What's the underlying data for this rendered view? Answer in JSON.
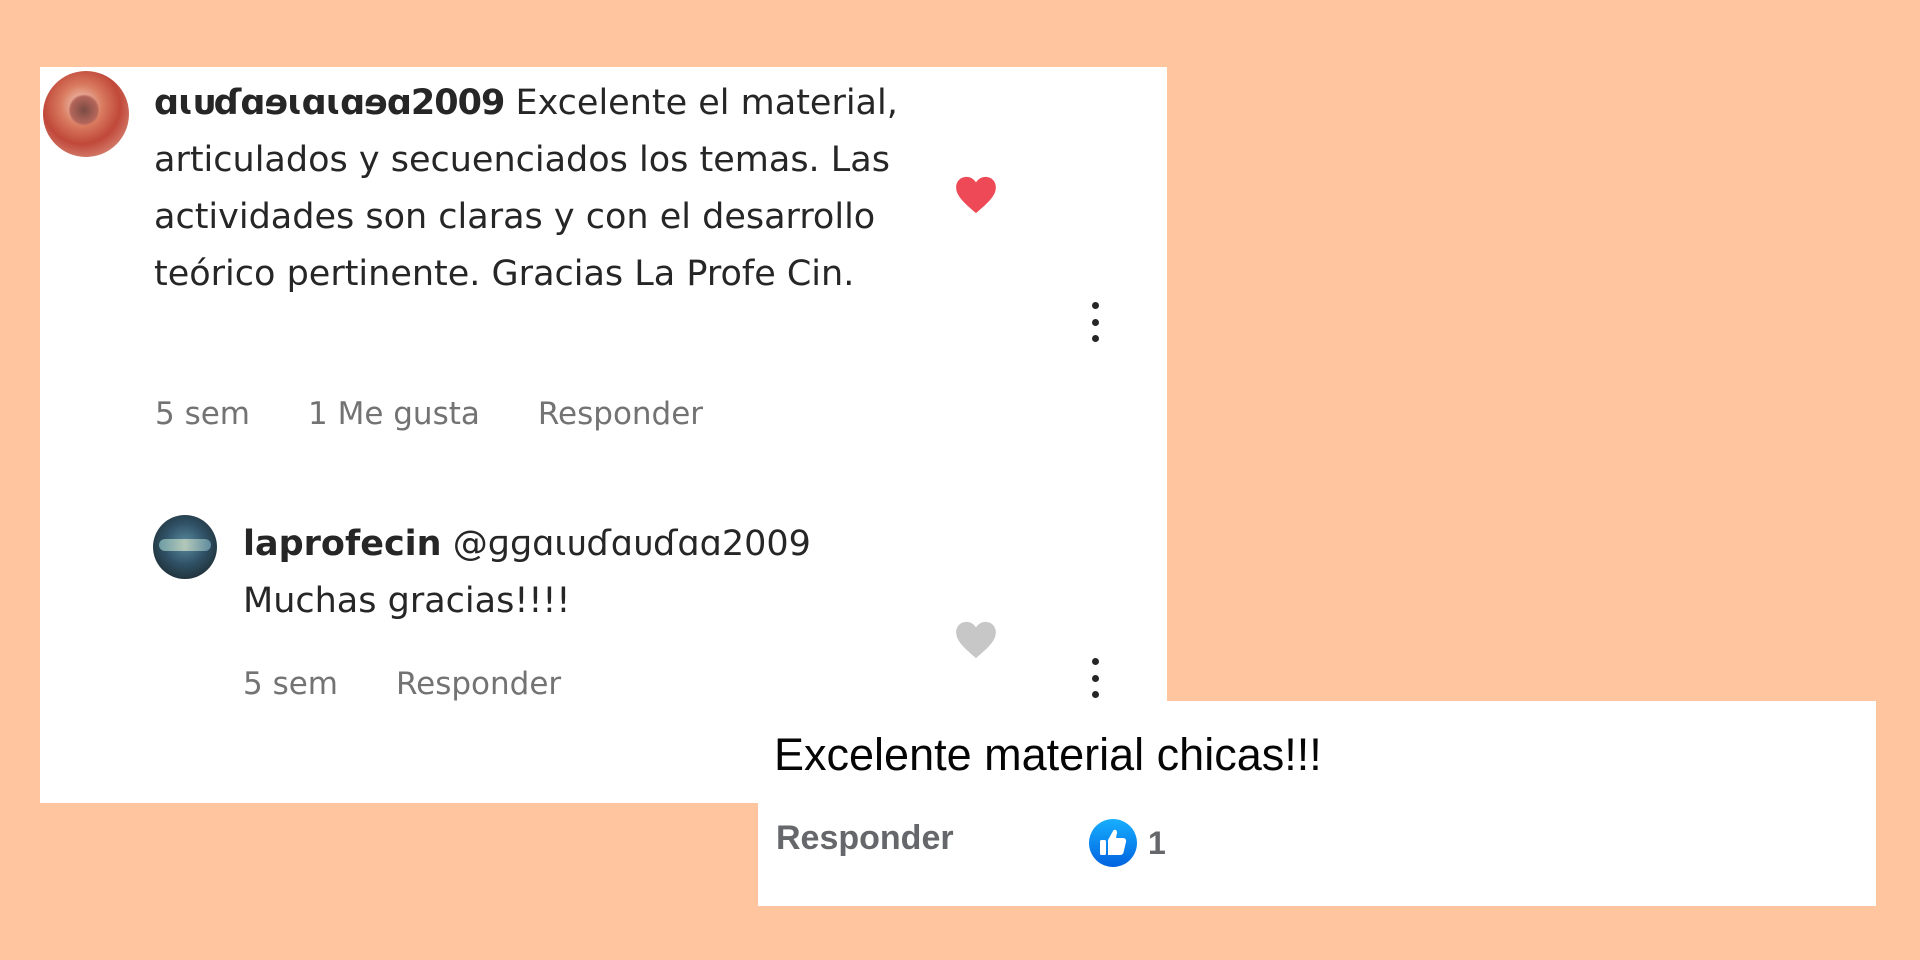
{
  "instagram_thread": {
    "comment": {
      "username": "ɑɩᴜɗɑɘɩɑɩɑɘɑ2009",
      "text": " Excelente el material, articulados y secuenciados los temas. Las actividades son claras y con el desarrollo teórico pertinente. Gracias La Profe Cin.",
      "time": "5 sem",
      "likes": "1 Me gusta",
      "reply_label": "Responder",
      "liked": true,
      "heart_color": "#ed4956"
    },
    "reply": {
      "username": "laprofecin",
      "mention": " @ɡɡɑɩᴜɗɑᴜɗɑɑ2009",
      "text": "Muchas gracias!!!!",
      "time": "5 sem",
      "reply_label": "Responder",
      "liked": false,
      "heart_color": "#c7c7c7"
    }
  },
  "facebook_comment": {
    "text": "Excelente material chicas!!!",
    "reply_label": "Responder",
    "like_count": "1",
    "like_badge_color": "#1877f2"
  },
  "colors": {
    "background": "#fec59e",
    "card": "#ffffff",
    "meta_text": "#737373"
  }
}
